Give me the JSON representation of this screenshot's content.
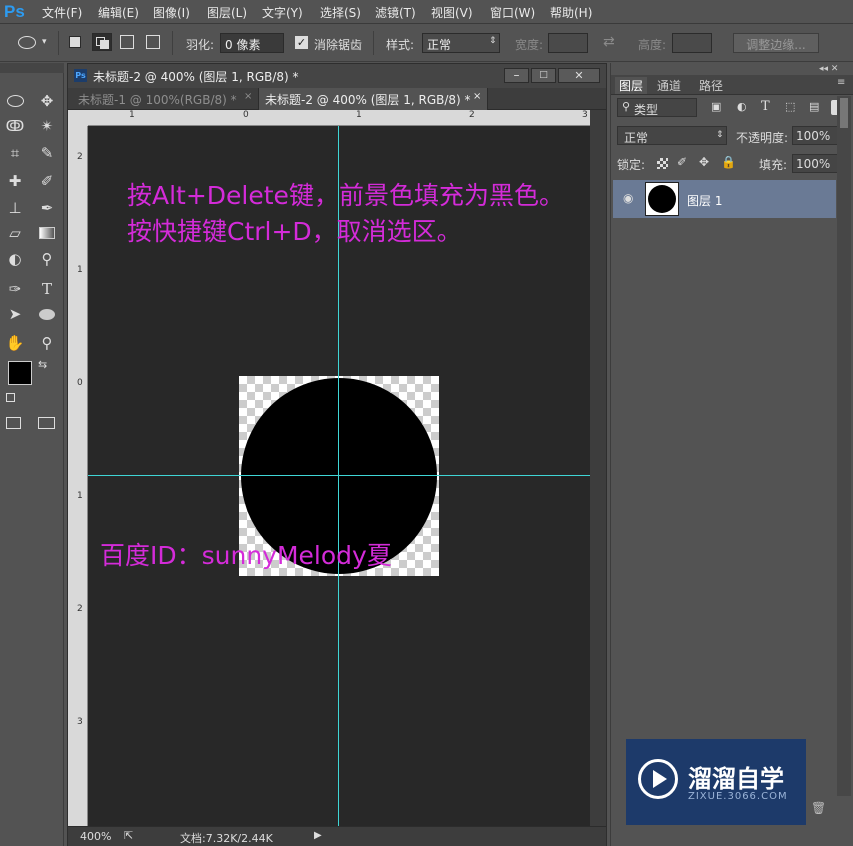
{
  "app": {
    "logo": "Ps"
  },
  "menu": [
    "文件(F)",
    "编辑(E)",
    "图像(I)",
    "图层(L)",
    "文字(Y)",
    "选择(S)",
    "滤镜(T)",
    "视图(V)",
    "窗口(W)",
    "帮助(H)"
  ],
  "options": {
    "feather_label": "羽化:",
    "feather_value": "0 像素",
    "antialias_label": "消除锯齿",
    "style_label": "样式:",
    "style_value": "正常",
    "width_label": "宽度:",
    "height_label": "高度:",
    "refine_edge": "调整边缘..."
  },
  "document": {
    "window_title": "未标题-2 @ 400% (图层 1, RGB/8) *",
    "tabs": [
      {
        "label": "未标题-1 @ 100%(RGB/8) *",
        "active": false
      },
      {
        "label": "未标题-2 @ 400% (图层 1, RGB/8) *",
        "active": true
      }
    ],
    "ruler_h": [
      "1",
      "0",
      "1",
      "2",
      "3"
    ],
    "ruler_v": [
      "2",
      "1",
      "0",
      "1",
      "2",
      "3"
    ],
    "annotation_line1": "按Alt+Delete键，前景色填充为黑色。",
    "annotation_line2": "按快捷键Ctrl+D，取消选区。",
    "annotation_id": "百度ID：sunnyMelody夏",
    "zoom": "400%",
    "doc_info": "文档:7.32K/2.44K"
  },
  "layers_panel": {
    "tabs": [
      "图层",
      "通道",
      "路径"
    ],
    "filter": "类型",
    "blend_mode": "正常",
    "opacity_label": "不透明度:",
    "opacity_value": "100%",
    "lock_label": "锁定:",
    "fill_label": "填充:",
    "fill_value": "100%",
    "layers": [
      {
        "name": "图层 1"
      }
    ]
  },
  "watermark": {
    "title": "溜溜自学",
    "url": "ZIXUE.3066.COM"
  },
  "colors": {
    "accent_magenta": "#d42bd9",
    "guide_cyan": "#3fd6d6",
    "layer_selected": "#6a7a95",
    "watermark_bg": "#1d3a6a"
  }
}
